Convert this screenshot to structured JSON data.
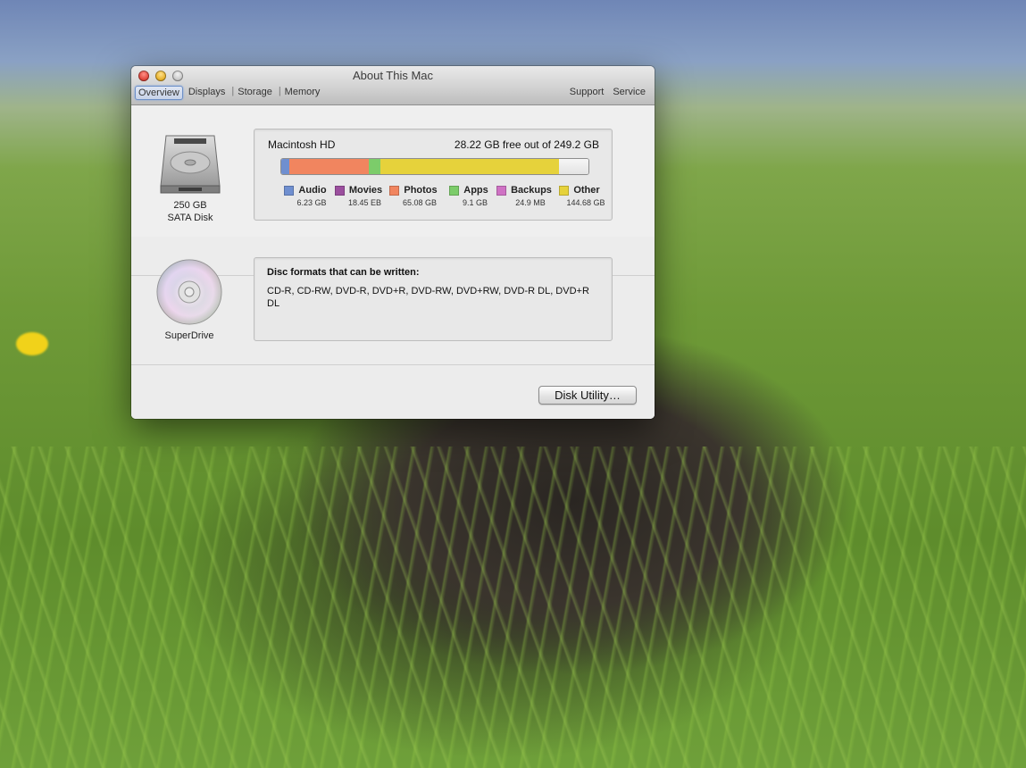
{
  "window": {
    "title": "About This Mac",
    "tabs": [
      "Overview",
      "Displays",
      "Storage",
      "Memory"
    ],
    "active_tab": "Overview",
    "links": [
      "Support",
      "Service"
    ]
  },
  "hard_drive": {
    "icon": "hard-drive-icon",
    "caption_line1": "250 GB",
    "caption_line2": "SATA Disk",
    "name": "Macintosh HD",
    "free_text": "28.22 GB free out of 249.2 GB",
    "usage": {
      "total_gb": 249.2,
      "segments": [
        {
          "name": "Audio",
          "value_gb": 6.23,
          "color": "#6f8fd0"
        },
        {
          "name": "Movies",
          "value_gb": 0.0,
          "color": "#9b4f9e"
        },
        {
          "name": "Photos",
          "value_gb": 65.08,
          "color": "#f1855f"
        },
        {
          "name": "Apps",
          "value_gb": 9.1,
          "color": "#7ccc6a"
        },
        {
          "name": "Backups",
          "value_gb": 0.0,
          "color": "#cf72c4"
        },
        {
          "name": "Other",
          "value_gb": 144.68,
          "color": "#e6d23b"
        }
      ]
    },
    "legend": [
      {
        "label": "Audio",
        "value": "6.23 GB",
        "color": "#6f8fd0"
      },
      {
        "label": "Movies",
        "value": "18.45 EB",
        "color": "#9b4f9e"
      },
      {
        "label": "Photos",
        "value": "65.08 GB",
        "color": "#f1855f"
      },
      {
        "label": "Apps",
        "value": "9.1 GB",
        "color": "#7ccc6a"
      },
      {
        "label": "Backups",
        "value": "24.9 MB",
        "color": "#cf72c4"
      },
      {
        "label": "Other",
        "value": "144.68 GB",
        "color": "#e6d23b"
      }
    ]
  },
  "optical_drive": {
    "icon": "superdrive-disc-icon",
    "caption": "SuperDrive",
    "formats_title": "Disc formats that can be written:",
    "formats": "CD-R, CD-RW, DVD-R, DVD+R, DVD-RW, DVD+RW, DVD-R DL, DVD+R DL"
  },
  "footer": {
    "disk_utility_label": "Disk Utility…"
  }
}
